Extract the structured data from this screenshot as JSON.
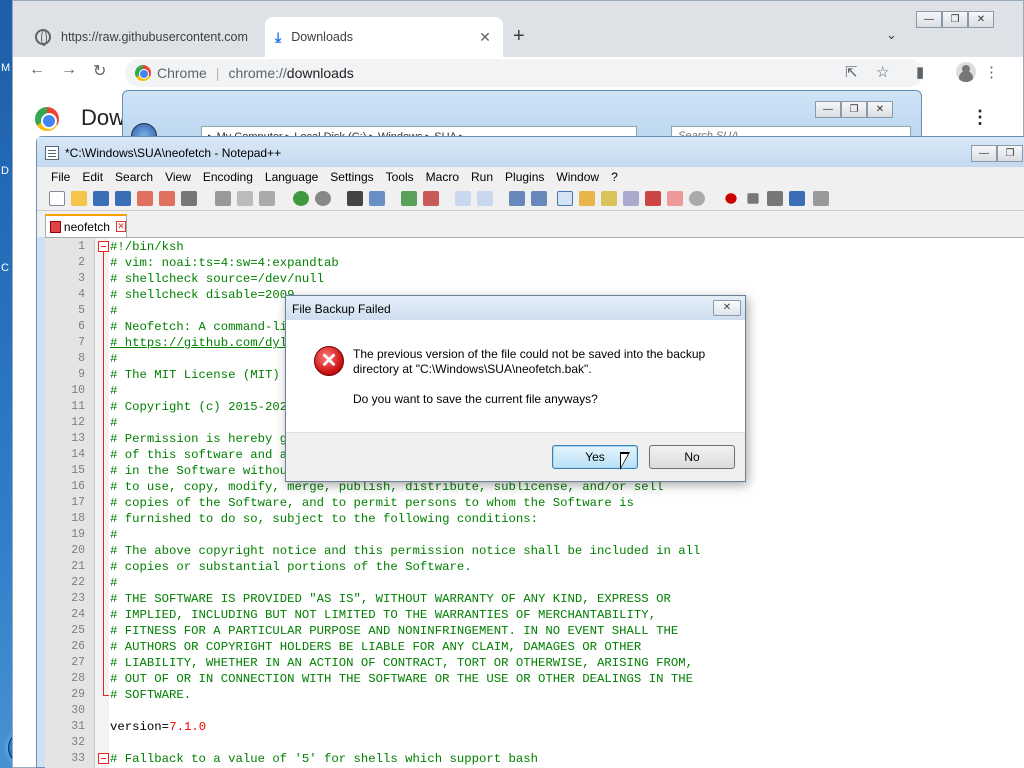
{
  "desktop": {
    "letters": [
      "M",
      "D",
      "C"
    ]
  },
  "chrome": {
    "tabs": [
      {
        "title": "https://raw.githubusercontent.com",
        "close": "✕"
      },
      {
        "title": "Downloads",
        "close": "✕"
      }
    ],
    "new_tab": "+",
    "omnibox": {
      "site": "Chrome",
      "host": "chrome://",
      "path": "downloads"
    },
    "page_heading": "Dow",
    "win_buttons": [
      "—",
      "❐",
      "✕"
    ]
  },
  "explorer": {
    "address": "▸ My Computer ▸ Local Disk (C:) ▸ Windows ▸ SUA ▸",
    "search_placeholder": "Search SUA"
  },
  "notepad": {
    "title": "*C:\\Windows\\SUA\\neofetch - Notepad++",
    "menu": [
      "File",
      "Edit",
      "Search",
      "View",
      "Encoding",
      "Language",
      "Settings",
      "Tools",
      "Macro",
      "Run",
      "Plugins",
      "Window",
      "?"
    ],
    "doc_tab": "neofetch",
    "lines": [
      {
        "n": "1",
        "t": "#!/bin/ksh",
        "c": "comment"
      },
      {
        "n": "2",
        "t": "# vim: noai:ts=4:sw=4:expandtab",
        "c": "comment"
      },
      {
        "n": "3",
        "t": "# shellcheck source=/dev/null",
        "c": "comment"
      },
      {
        "n": "4",
        "t": "# shellcheck disable=2009",
        "c": "comment"
      },
      {
        "n": "5",
        "t": "#",
        "c": "comment"
      },
      {
        "n": "6",
        "t": "# Neofetch: A command-line system information tool written in bash 3.2+.",
        "c": "comment"
      },
      {
        "n": "7",
        "t": "# https://github.com/dylanaraps/neofetch",
        "c": "url"
      },
      {
        "n": "8",
        "t": "#",
        "c": "comment"
      },
      {
        "n": "9",
        "t": "# The MIT License (MIT)",
        "c": "comment"
      },
      {
        "n": "10",
        "t": "#",
        "c": "comment"
      },
      {
        "n": "11",
        "t": "# Copyright (c) 2015-2020 Dylan Araps",
        "c": "comment"
      },
      {
        "n": "12",
        "t": "#",
        "c": "comment"
      },
      {
        "n": "13",
        "t": "# Permission is hereby granted, free of charge, to any person obtaining a copy",
        "c": "comment"
      },
      {
        "n": "14",
        "t": "# of this software and associated documentation files (the \"Software\"), to deal",
        "c": "comment"
      },
      {
        "n": "15",
        "t": "# in the Software without restriction, including without limitation the rights",
        "c": "comment"
      },
      {
        "n": "16",
        "t": "# to use, copy, modify, merge, publish, distribute, sublicense, and/or sell",
        "c": "comment"
      },
      {
        "n": "17",
        "t": "# copies of the Software, and to permit persons to whom the Software is",
        "c": "comment"
      },
      {
        "n": "18",
        "t": "# furnished to do so, subject to the following conditions:",
        "c": "comment"
      },
      {
        "n": "19",
        "t": "#",
        "c": "comment"
      },
      {
        "n": "20",
        "t": "# The above copyright notice and this permission notice shall be included in all",
        "c": "comment"
      },
      {
        "n": "21",
        "t": "# copies or substantial portions of the Software.",
        "c": "comment"
      },
      {
        "n": "22",
        "t": "#",
        "c": "comment"
      },
      {
        "n": "23",
        "t": "# THE SOFTWARE IS PROVIDED \"AS IS\", WITHOUT WARRANTY OF ANY KIND, EXPRESS OR",
        "c": "comment"
      },
      {
        "n": "24",
        "t": "# IMPLIED, INCLUDING BUT NOT LIMITED TO THE WARRANTIES OF MERCHANTABILITY,",
        "c": "comment"
      },
      {
        "n": "25",
        "t": "# FITNESS FOR A PARTICULAR PURPOSE AND NONINFRINGEMENT. IN NO EVENT SHALL THE",
        "c": "comment"
      },
      {
        "n": "26",
        "t": "# AUTHORS OR COPYRIGHT HOLDERS BE LIABLE FOR ANY CLAIM, DAMAGES OR OTHER",
        "c": "comment"
      },
      {
        "n": "27",
        "t": "# LIABILITY, WHETHER IN AN ACTION OF CONTRACT, TORT OR OTHERWISE, ARISING FROM,",
        "c": "comment"
      },
      {
        "n": "28",
        "t": "# OUT OF OR IN CONNECTION WITH THE SOFTWARE OR THE USE OR OTHER DEALINGS IN THE",
        "c": "comment"
      },
      {
        "n": "29",
        "t": "# SOFTWARE.",
        "c": "comment"
      },
      {
        "n": "30",
        "t": "",
        "c": "plain"
      },
      {
        "n": "31",
        "t": "version=",
        "c": "plain",
        "val": "7.1.0"
      },
      {
        "n": "32",
        "t": "",
        "c": "plain"
      },
      {
        "n": "33",
        "t": "# Fallback to a value of '5' for shells which support bash",
        "c": "comment"
      }
    ]
  },
  "dialog": {
    "title": "File Backup Failed",
    "close": "✕",
    "message_line1": "The previous version of the file could not be saved into the backup",
    "message_line2": "directory at \"C:\\Windows\\SUA\\neofetch.bak\".",
    "question": "Do you want to save the current file anyways?",
    "yes": "Yes",
    "no": "No"
  }
}
